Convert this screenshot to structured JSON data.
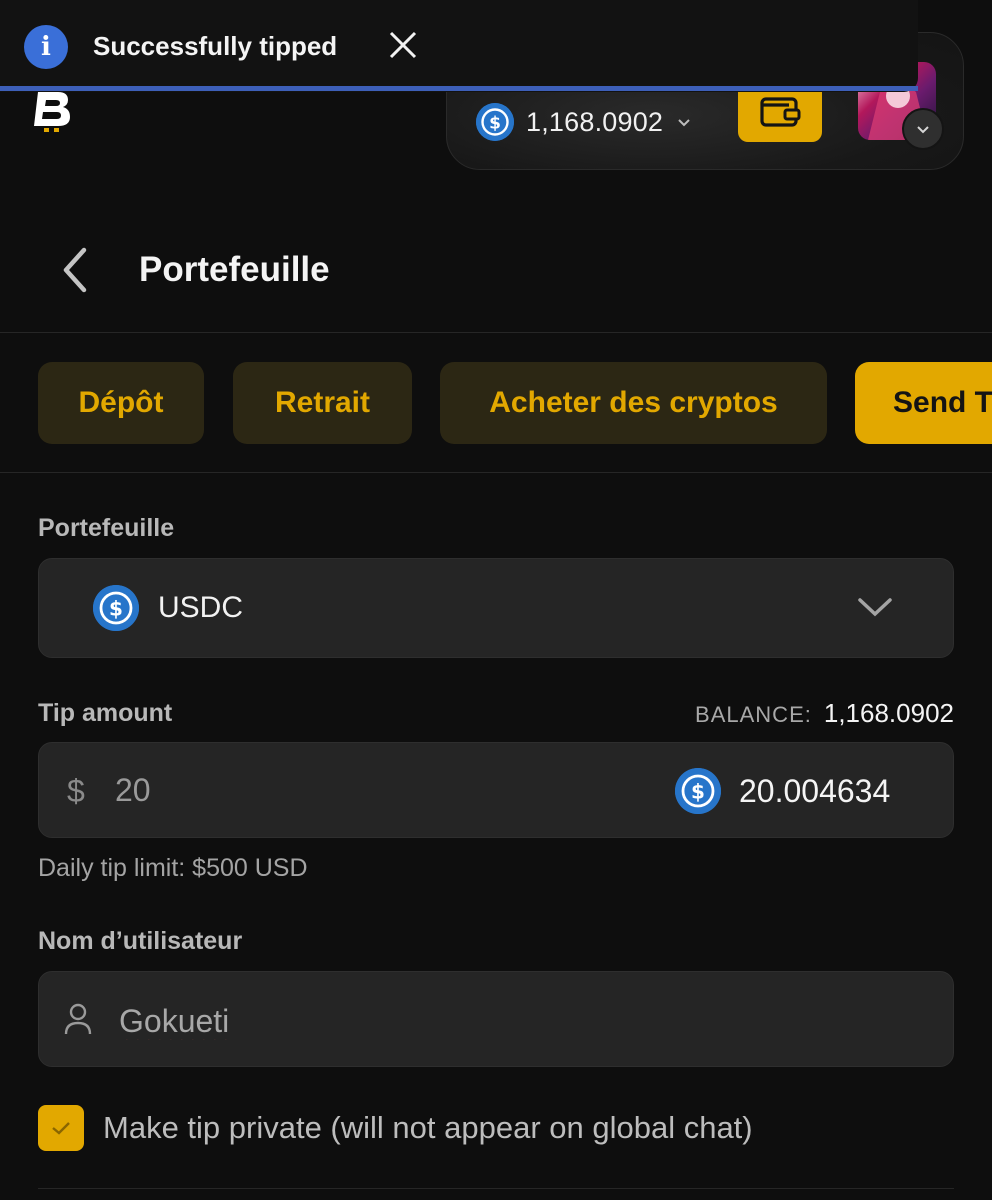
{
  "toast": {
    "message": "Successfully tipped",
    "accent": "#3d5fb8"
  },
  "header": {
    "balance": "1,168.0902",
    "brand_color": "#e2a800"
  },
  "page": {
    "title": "Portefeuille"
  },
  "tabs": [
    {
      "label": "Dépôt"
    },
    {
      "label": "Retrait"
    },
    {
      "label": "Acheter des cryptos"
    },
    {
      "label": "Send T"
    }
  ],
  "form": {
    "wallet_label": "Portefeuille",
    "currency": "USDC",
    "tip_label": "Tip amount",
    "balance_label": "BALANCE:",
    "balance_value": "1,168.0902",
    "currency_symbol": "$",
    "amount_value": "20",
    "crypto_amount": "20.004634",
    "daily_limit": "Daily tip limit: $500 USD",
    "username_label": "Nom d’utilisateur",
    "username_value": "Gokueti",
    "private_label": "Make tip private (will not appear on global chat)",
    "private_checked": true
  },
  "icons": {
    "info": "i"
  }
}
